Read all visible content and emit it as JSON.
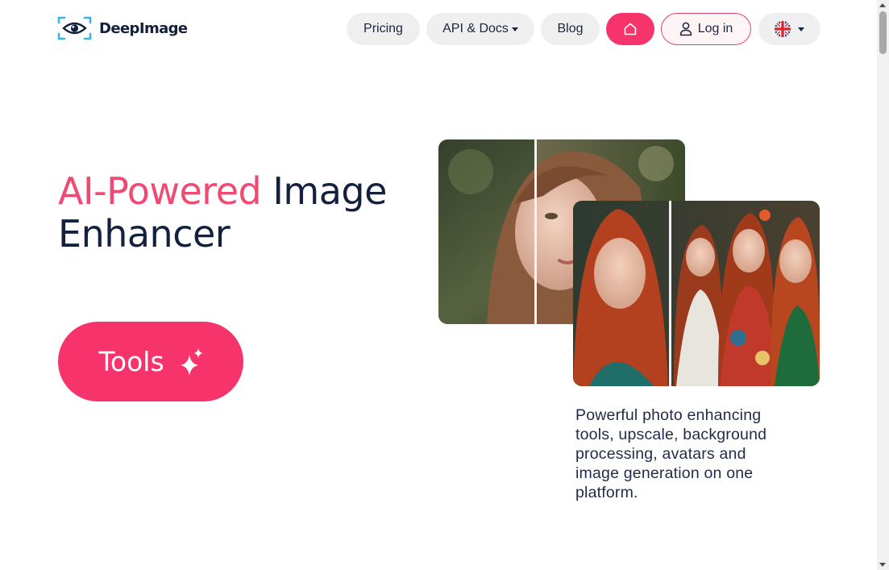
{
  "header": {
    "logo_text": "DeepImage",
    "logo_icon": "eye-scan-icon",
    "nav": {
      "pricing": "Pricing",
      "api_docs": "API & Docs",
      "blog": "Blog",
      "home_icon": "home-icon",
      "login": "Log in",
      "login_icon": "user-icon",
      "language_icon": "uk-flag-icon"
    }
  },
  "hero": {
    "title_accent": "AI-Powered",
    "title_rest": " Image",
    "title_line2": "Enhancer",
    "tools_button": "Tools",
    "tools_icon": "sparkles-icon",
    "description": "Powerful photo enhancing tools, upscale, background processing, avatars and image generation on one platform."
  },
  "colors": {
    "accent": "#f6336a",
    "title_accent": "#ef4a71",
    "text_dark": "#13213f",
    "logo_blue": "#3ab4e8",
    "pill_bg": "#efefef"
  }
}
